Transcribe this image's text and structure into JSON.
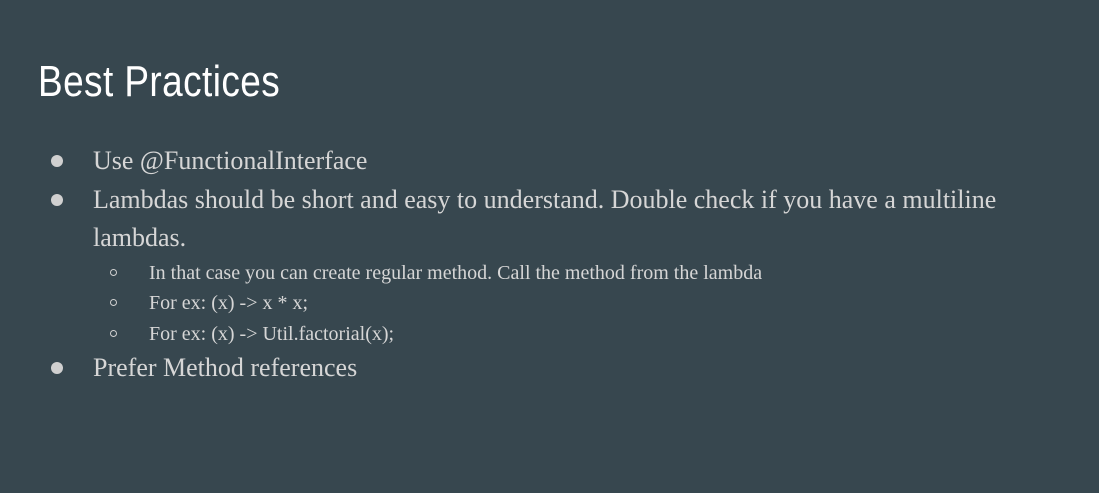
{
  "slide": {
    "title": "Best Practices",
    "bullets": [
      "Use @FunctionalInterface",
      "Lambdas should be short and easy to understand. Double check if you have a multiline lambdas."
    ],
    "sub_bullets": [
      "In that case you can create regular method. Call the method from the lambda",
      "For ex: (x) -> x * x;",
      "For ex: (x) -> Util.factorial(x);"
    ],
    "last_bullet": "Prefer Method references"
  },
  "colors": {
    "background": "#37474f",
    "title": "#ffffff",
    "body_text": "#d6d6d6"
  }
}
